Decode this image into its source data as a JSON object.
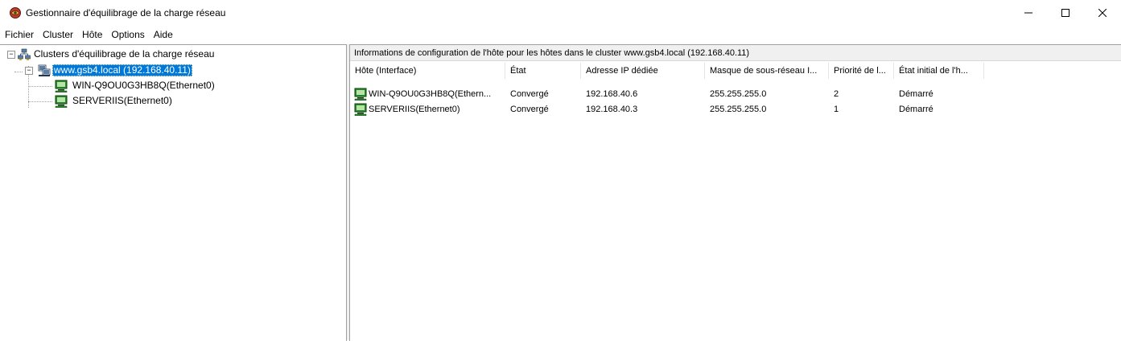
{
  "window": {
    "title": "Gestionnaire d'équilibrage de la charge réseau",
    "controls": {
      "minimize": "—",
      "maximize": "☐",
      "close": "✕"
    }
  },
  "menu": [
    "Fichier",
    "Cluster",
    "Hôte",
    "Options",
    "Aide"
  ],
  "tree": {
    "root": {
      "label": "Clusters d'équilibrage de la charge réseau",
      "icon": "clusters-icon",
      "expander": "−"
    },
    "cluster": {
      "label": "www.gsb4.local (192.168.40.11)",
      "icon": "cluster-icon",
      "expander": "−"
    },
    "hosts": [
      {
        "label": "WIN-Q9OU0G3HB8Q(Ethernet0)",
        "icon": "host-computer-icon"
      },
      {
        "label": "SERVERIIS(Ethernet0)",
        "icon": "host-computer-icon"
      }
    ]
  },
  "details": {
    "header": "Informations de configuration de l'hôte pour les hôtes dans le cluster www.gsb4.local (192.168.40.11)",
    "columns": [
      "Hôte (Interface)",
      "État",
      "Adresse IP dédiée",
      "Masque de sous-réseau I...",
      "Priorité de l...",
      "État initial de l'h..."
    ],
    "rows": [
      [
        "WIN-Q9OU0G3HB8Q(Ethern...",
        "Convergé",
        "192.168.40.6",
        "255.255.255.0",
        "2",
        "Démarré"
      ],
      [
        "SERVERIIS(Ethernet0)",
        "Convergé",
        "192.168.40.3",
        "255.255.255.0",
        "1",
        "Démarré"
      ]
    ]
  },
  "colors": {
    "selection": "#0078d7",
    "host_icon_green": "#2e8b2e"
  }
}
